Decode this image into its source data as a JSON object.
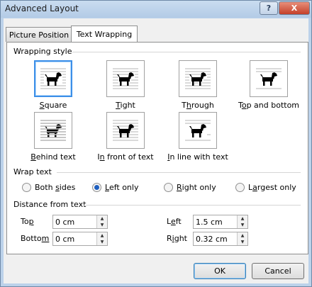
{
  "window": {
    "title": "Advanced Layout",
    "help_glyph": "?",
    "close_glyph": "X"
  },
  "tabs": [
    {
      "label": "Picture Position",
      "active": false
    },
    {
      "label": "Text Wrapping",
      "active": true
    }
  ],
  "wrapping_style": {
    "heading": "Wrapping style",
    "options": [
      {
        "pre": "",
        "key": "S",
        "post": "quare",
        "selected": true
      },
      {
        "pre": "",
        "key": "T",
        "post": "ight",
        "selected": false
      },
      {
        "pre": "T",
        "key": "h",
        "post": "rough",
        "selected": false
      },
      {
        "pre": "T",
        "key": "o",
        "post": "p and bottom",
        "selected": false
      },
      {
        "pre": "",
        "key": "B",
        "post": "ehind text",
        "selected": false
      },
      {
        "pre": "I",
        "key": "n",
        "post": " front of text",
        "selected": false
      },
      {
        "pre": "",
        "key": "I",
        "post": "n line with text",
        "selected": false
      }
    ]
  },
  "wrap_text": {
    "heading": "Wrap text",
    "options": [
      {
        "pre": "Both ",
        "key": "s",
        "post": "ides",
        "checked": false
      },
      {
        "pre": "",
        "key": "L",
        "post": "eft only",
        "checked": true
      },
      {
        "pre": "",
        "key": "R",
        "post": "ight only",
        "checked": false
      },
      {
        "pre": "L",
        "key": "a",
        "post": "rgest only",
        "checked": false
      }
    ]
  },
  "distance": {
    "heading": "Distance from text",
    "top": {
      "pre": "To",
      "key": "p",
      "post": "",
      "value": "0 cm"
    },
    "bottom": {
      "pre": "Botto",
      "key": "m",
      "post": "",
      "value": "0 cm"
    },
    "left": {
      "pre": "L",
      "key": "e",
      "post": "ft",
      "value": "1.5 cm"
    },
    "right": {
      "pre": "R",
      "key": "i",
      "post": "ght",
      "value": "0.32 cm"
    }
  },
  "buttons": {
    "ok": "OK",
    "cancel": "Cancel"
  },
  "icons": {
    "dog": "dog-silhouette-icon",
    "spin_up": "▲",
    "spin_down": "▼"
  },
  "colors": {
    "selection": "#3c8fe8",
    "title_bar": "#bcd2ea",
    "close": "#c4402a"
  }
}
